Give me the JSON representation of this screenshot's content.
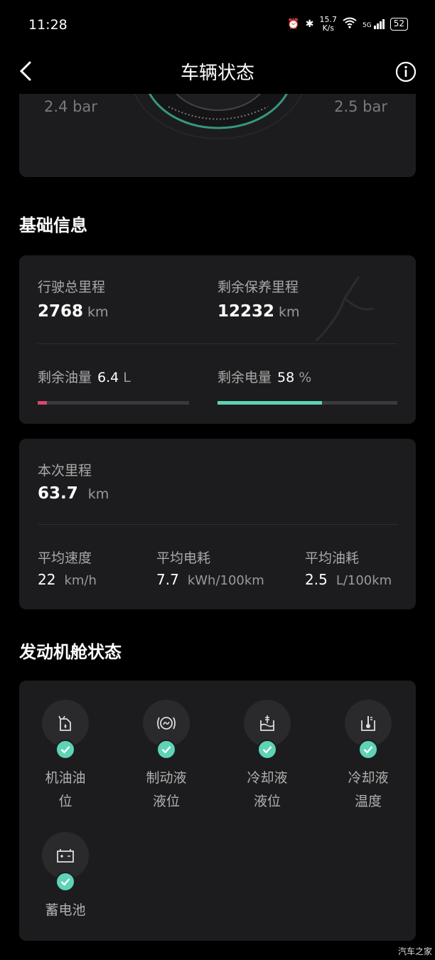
{
  "status_bar": {
    "time": "11:28",
    "net_speed_top": "15.7",
    "net_speed_bottom": "K/s",
    "signal_label": "5G",
    "battery": "52"
  },
  "nav": {
    "title": "车辆状态"
  },
  "tires": {
    "left_pressure": "2.4 bar",
    "right_pressure": "2.5 bar"
  },
  "basic_info": {
    "section_title": "基础信息",
    "total_mileage_label": "行驶总里程",
    "total_mileage_value": "2768",
    "total_mileage_unit": "km",
    "maintenance_label": "剩余保养里程",
    "maintenance_value": "12232",
    "maintenance_unit": "km",
    "fuel_label": "剩余油量",
    "fuel_value": "6.4",
    "fuel_unit": "L",
    "fuel_bar_fraction": 0.06,
    "fuel_bar_color": "#d9476f",
    "battery_label": "剩余电量",
    "battery_value": "58",
    "battery_unit": "%",
    "battery_bar_fraction": 0.58,
    "battery_bar_color": "#5ed3b5"
  },
  "trip": {
    "label": "本次里程",
    "value": "63.7",
    "unit": "km",
    "avg_speed_label": "平均速度",
    "avg_speed_value": "22",
    "avg_speed_unit": "km/h",
    "avg_elec_label": "平均电耗",
    "avg_elec_value": "7.7",
    "avg_elec_unit": "kWh/100km",
    "avg_fuel_label": "平均油耗",
    "avg_fuel_value": "2.5",
    "avg_fuel_unit": "L/100km"
  },
  "engine": {
    "section_title": "发动机舱状态",
    "items": [
      {
        "line1": "机油油",
        "line2": "位",
        "icon": "oil-level-icon",
        "status": "ok"
      },
      {
        "line1": "制动液",
        "line2": "液位",
        "icon": "brake-fluid-icon",
        "status": "ok"
      },
      {
        "line1": "冷却液",
        "line2": "液位",
        "icon": "coolant-level-icon",
        "status": "ok"
      },
      {
        "line1": "冷却液",
        "line2": "温度",
        "icon": "coolant-temp-icon",
        "status": "ok"
      },
      {
        "line1": "蓄电池",
        "line2": "",
        "icon": "battery-icon",
        "status": "ok"
      }
    ]
  },
  "watermark": "汽车之家",
  "colors": {
    "accent": "#5ed3b5",
    "card_bg": "#1c1c1e",
    "fuel_bar": "#d9476f"
  }
}
